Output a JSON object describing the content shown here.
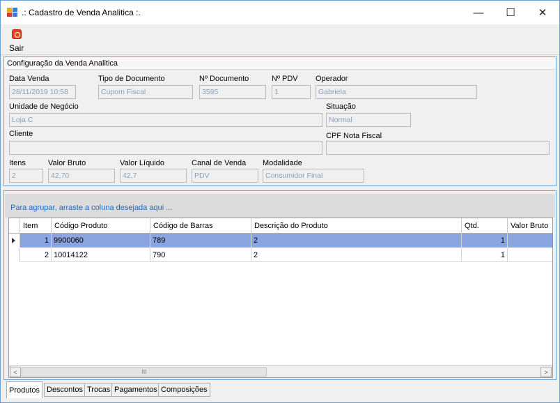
{
  "window": {
    "title": ".: Cadastro de Venda Analitica :.",
    "min_glyph": "—",
    "max_glyph": "☐",
    "close_glyph": "✕"
  },
  "toolbar": {
    "sair_label": "Sair"
  },
  "config": {
    "header": "Configuração da Venda Analitica",
    "data_venda": {
      "label": "Data Venda",
      "value": "28/11/2019 10:58"
    },
    "tipo_documento": {
      "label": "Tipo de Documento",
      "value": "Cupom Fiscal"
    },
    "n_documento": {
      "label": "Nº Documento",
      "value": "3595"
    },
    "n_pdv": {
      "label": "Nº PDV",
      "value": "1"
    },
    "operador": {
      "label": "Operador",
      "value": "Gabriela"
    },
    "unidade_negocio": {
      "label": "Unidade de Negócio",
      "value": "Loja C"
    },
    "situacao": {
      "label": "Situação",
      "value": "Normal"
    },
    "cliente": {
      "label": "Cliente",
      "value": ""
    },
    "cpf_nota": {
      "label": "CPF Nota Fiscal",
      "value": ""
    },
    "itens": {
      "label": "Itens",
      "value": "2"
    },
    "valor_bruto": {
      "label": "Valor Bruto",
      "value": "42,70"
    },
    "valor_liquido": {
      "label": "Valor Líquido",
      "value": "42,7"
    },
    "canal_venda": {
      "label": "Canal de Venda",
      "value": "PDV"
    },
    "modalidade": {
      "label": "Modalidade",
      "value": "Consumidor Final"
    }
  },
  "grid": {
    "group_hint": "Para agrupar, arraste a coluna desejada aqui ...",
    "columns": [
      "Item",
      "Código Produto",
      "Código de Barras",
      "Descrição do Produto",
      "Qtd.",
      "Valor Bruto"
    ],
    "rows": [
      {
        "item": "1",
        "codigo": "9900060",
        "barras": "789",
        "descricao": "2",
        "qtd": "1",
        "valor": ""
      },
      {
        "item": "2",
        "codigo": "10014122",
        "barras": "790",
        "descricao": "2",
        "qtd": "1",
        "valor": ""
      }
    ],
    "scroll_grip": "III",
    "scroll_left": "<",
    "scroll_right": ">"
  },
  "tabs": [
    "Produtos",
    "Descontos",
    "Trocas",
    "Pagamentos",
    "Composições"
  ]
}
